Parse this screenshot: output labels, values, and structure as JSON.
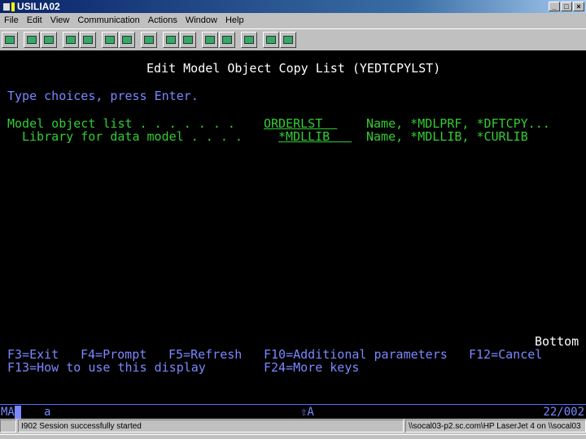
{
  "window": {
    "title": "USILIA02",
    "minimize": "_",
    "maximize": "□",
    "close": "×"
  },
  "menu": [
    "File",
    "Edit",
    "View",
    "Communication",
    "Actions",
    "Window",
    "Help"
  ],
  "toolbar": [
    "display-icon",
    "copy-icon",
    "paste-icon",
    "send-icon",
    "receive-icon",
    "screen-icon",
    "screen2-icon",
    "keyboard-icon",
    "record-macro-icon",
    "stop-macro-icon",
    "play-macro-icon",
    "pause-macro-icon",
    "clipboard-icon",
    "globe-icon",
    "edit-icon"
  ],
  "screen": {
    "title": "Edit Model Object Copy List (YEDTCPYLST)",
    "instruction": "Type choices, press Enter.",
    "fields": [
      {
        "label": "Model object list . . . . . . .",
        "value": "ORDERLST  ",
        "hint": "Name, *MDLPRF, *DFTCPY..."
      },
      {
        "label": "Library for data model . . . .",
        "value": "*MDLLIB   ",
        "hint": "Name, *MDLLIB, *CURLIB"
      }
    ],
    "more": "Bottom",
    "fkeys1": [
      "F3=Exit",
      "F4=Prompt",
      "F5=Refresh",
      "F10=Additional parameters",
      "F12=Cancel"
    ],
    "fkeys2": [
      "F13=How to use this display",
      "F24=More keys"
    ]
  },
  "oia": {
    "mode": "MA",
    "a": "a",
    "shift": "⇧A",
    "position": "22/002"
  },
  "statusbar": {
    "message": "I902  Session successfully started",
    "printer": "\\\\socal03-p2.sc.com\\HP LaserJet 4 on \\\\socal03"
  }
}
